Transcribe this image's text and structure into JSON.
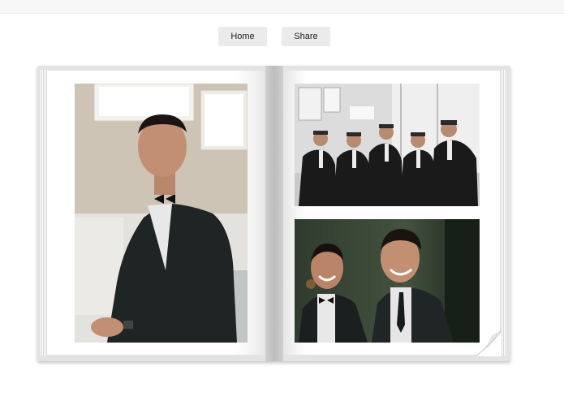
{
  "nav": {
    "home_label": "Home",
    "share_label": "Share"
  },
  "photos": [
    {
      "name": "groom-portrait",
      "description_icon": "photo-icon"
    },
    {
      "name": "groomsmen-group",
      "description_icon": "photo-icon"
    },
    {
      "name": "groom-and-groomsman-laughing",
      "description_icon": "photo-icon"
    }
  ],
  "colors": {
    "book_cover": "#e3e3e3",
    "page": "#ffffff",
    "button_bg": "#ebebeb"
  }
}
